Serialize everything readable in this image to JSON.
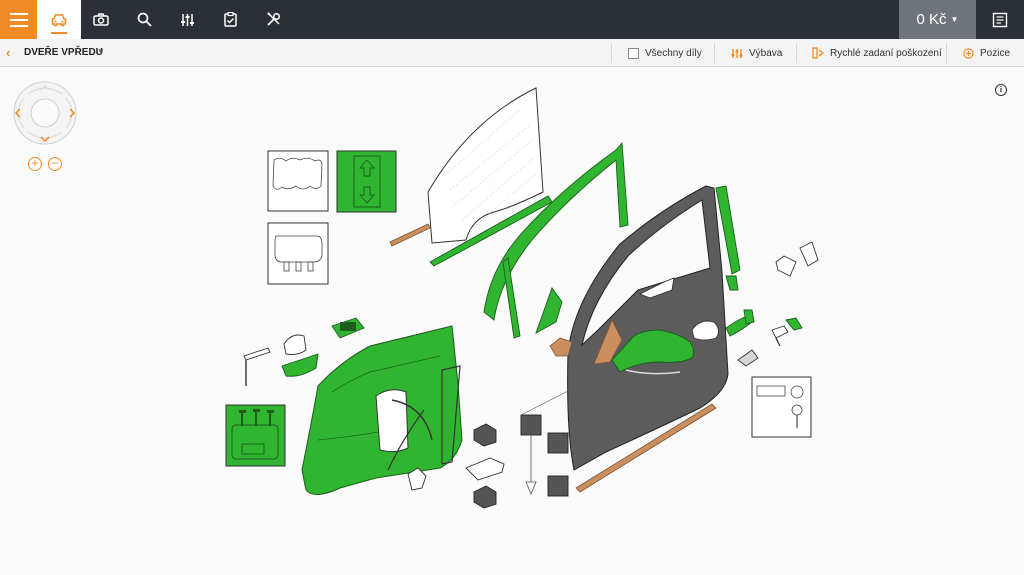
{
  "topbar": {
    "icons": [
      "menu-icon",
      "car-icon",
      "camera-icon",
      "search-icon",
      "sliders-icon",
      "clipboard-check-icon",
      "tools-icon"
    ],
    "price": "0 Kč",
    "receipt_icon": "receipt-icon"
  },
  "subbar": {
    "section_title": "DVEŘE VPŘEDU",
    "all_parts_label": "Všechny díly",
    "equipment_label": "Výbava",
    "quick_damage_label": "Rychlé zadaní poškození",
    "position_label": "Pozice"
  },
  "colors": {
    "accent": "#f08a24",
    "topbar": "#2b2f36",
    "selected_part": "#2fb52f",
    "door_shell": "#555555",
    "trim": "#c98f5e"
  },
  "diagram": {
    "info_icon": "i",
    "zoom_in": "+",
    "zoom_out": "−"
  }
}
